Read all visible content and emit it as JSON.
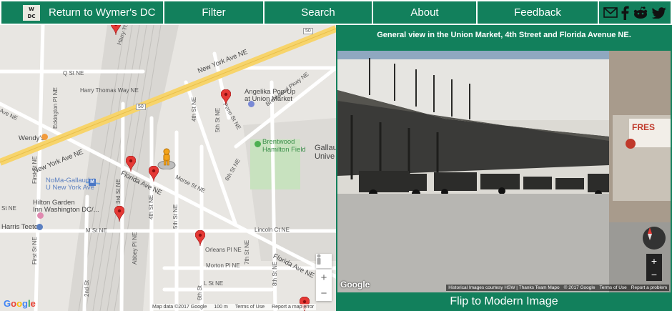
{
  "nav": {
    "logo_line1": "W",
    "logo_line2": "DC",
    "home_label": "Return to Wymer's DC",
    "filter_label": "Filter",
    "search_label": "Search",
    "about_label": "About",
    "feedback_label": "Feedback",
    "social_icons": [
      "email-icon",
      "facebook-icon",
      "reddit-icon",
      "twitter-icon"
    ]
  },
  "map": {
    "streets": {
      "new_york_ave_ne_1": "New York Ave NE",
      "new_york_ave_ne_2": "New York Ave NE",
      "florida_ave_ne_1": "Florida Ave NE",
      "florida_ave_ne_2": "Florida Ave NE",
      "q_st_ne": "Q St NE",
      "harry_thomas": "Harry Thomas Way NE",
      "eckington": "Eckington Pl NE",
      "morse": "Morse St NE",
      "m_st": "M St NE",
      "orleans": "Orleans Pl NE",
      "morton": "Morton Pl NE",
      "l_st": "L St NE",
      "lincoln": "Lincoln Ct NE",
      "brentwood_pkwy": "Brentwood Pkwy NE",
      "penn": "Penn St NE",
      "fourth": "4th St NE",
      "fifth": "5th St NE",
      "sixth": "6th St NE",
      "third": "3rd St NE",
      "fourth_b": "4th St NE",
      "fifth_b": "5th St NE",
      "sixth_b": "6th St",
      "seventh": "7th St NE",
      "eighth": "8th St NE",
      "second": "2nd St",
      "first": "First St NE",
      "first_b": "First St NE",
      "abbey": "Abbey Pl NE",
      "ave_ne": "Ave NE",
      "st_ne": "St NE",
      "route": "50"
    },
    "places": {
      "angelika": "Angelika Pop-Up",
      "angelika2": "at Union Market",
      "brentwood": "Brentwood",
      "hamilton": "Hamilton Field",
      "gallaudet": "Gallau",
      "gallaudet2": "Unive",
      "wendys": "Wendy's",
      "noma": "NoMa-Gallaudet",
      "noma2": "U New York Ave",
      "hilton": "Hilton Garden",
      "hilton2": "Inn Washington DC/...",
      "harris": "Harris Teeter"
    },
    "footer": {
      "map_data": "Map data ©2017 Google",
      "scale": "100 m",
      "terms": "Terms of Use",
      "report": "Report a map error"
    },
    "zoom_in": "+",
    "zoom_out": "−",
    "google": [
      "G",
      "o",
      "o",
      "g",
      "l",
      "e"
    ]
  },
  "panel": {
    "caption": "General view in the Union Market, 4th Street and Florida Avenue NE.",
    "flip_label": "Flip to Modern Image",
    "sv_google": "Google",
    "sv_credit": "Historical Images courtesy HSW | Thanks Team Mapo",
    "sv_copyright": "© 2017 Google",
    "sv_terms": "Terms of Use",
    "sv_report": "Report a problem",
    "sv_zoom_in": "+",
    "sv_zoom_out": "−",
    "fresh": "FRES"
  },
  "colors": {
    "accent": "#12805c",
    "pin": "#e53935"
  }
}
